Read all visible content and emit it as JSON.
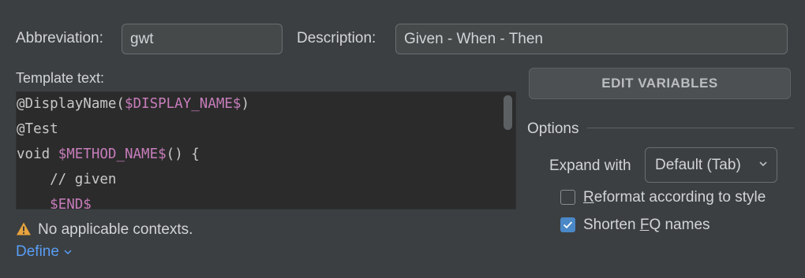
{
  "abbreviation": {
    "label": "Abbreviation:",
    "value": "gwt"
  },
  "description": {
    "label": "Description:",
    "value": "Given - When - Then"
  },
  "template": {
    "label": "Template text:",
    "lines": [
      [
        {
          "t": "@DisplayName(",
          "c": "plain"
        },
        {
          "t": "$DISPLAY_NAME$",
          "c": "var"
        },
        {
          "t": ")",
          "c": "plain"
        }
      ],
      [
        {
          "t": "@Test",
          "c": "plain"
        }
      ],
      [
        {
          "t": "void ",
          "c": "plain"
        },
        {
          "t": "$METHOD_NAME$",
          "c": "var"
        },
        {
          "t": "() {",
          "c": "plain"
        }
      ],
      [
        {
          "t": "    // given",
          "c": "plain"
        }
      ],
      [
        {
          "t": "    ",
          "c": "plain"
        },
        {
          "t": "$END$",
          "c": "var"
        }
      ]
    ]
  },
  "edit_variables_label": "EDIT VARIABLES",
  "options": {
    "title": "Options",
    "expand_label": "Expand with",
    "expand_value": "Default (Tab)",
    "reformat": {
      "pre": "",
      "mnemonic": "R",
      "post": "eformat according to style",
      "checked": false
    },
    "shorten": {
      "pre": "Shorten ",
      "mnemonic": "F",
      "post": "Q names",
      "checked": true
    }
  },
  "warning": {
    "text": "No applicable contexts.",
    "icon": "warning-triangle-icon",
    "color": "#e8a33d"
  },
  "define_label": "Define",
  "colors": {
    "accent": "#589df6",
    "template_var": "#c77dbb",
    "checkbox": "#4a88c7"
  }
}
